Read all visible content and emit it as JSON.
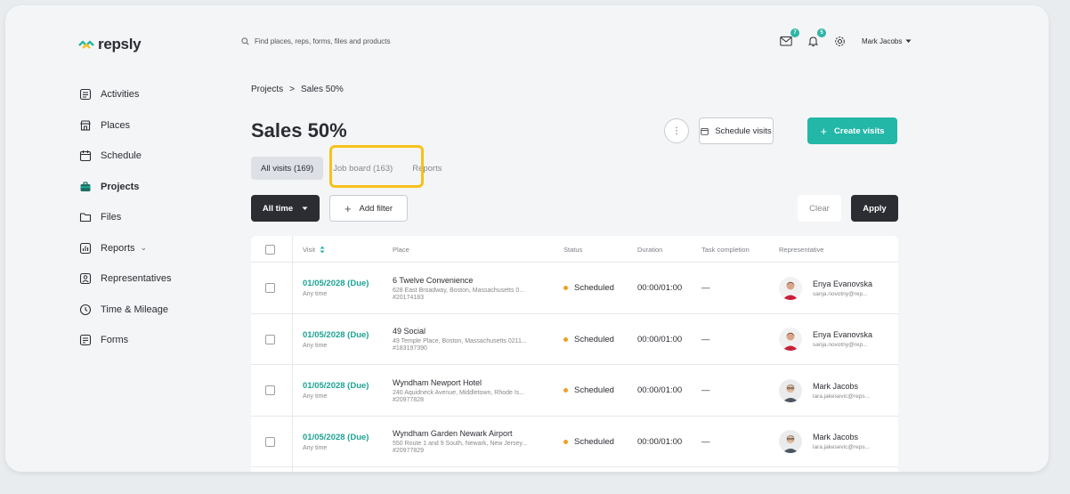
{
  "app": {
    "logo_text": "repsly",
    "brand_color": "#23b7a7",
    "highlight_color": "#f6c11a"
  },
  "topbar": {
    "search_placeholder": "Find places, reps, forms, files and products",
    "mail_badge": "7",
    "bell_badge": "5",
    "user_name": "Mark Jacobs"
  },
  "sidebar": {
    "items": [
      {
        "label": "Activities",
        "icon": "list-icon"
      },
      {
        "label": "Places",
        "icon": "store-icon"
      },
      {
        "label": "Schedule",
        "icon": "calendar-icon"
      },
      {
        "label": "Projects",
        "icon": "briefcase-icon"
      },
      {
        "label": "Files",
        "icon": "folder-icon"
      },
      {
        "label": "Reports",
        "icon": "chart-icon"
      },
      {
        "label": "Representatives",
        "icon": "person-icon"
      },
      {
        "label": "Time & Mileage",
        "icon": "clock-icon"
      },
      {
        "label": "Forms",
        "icon": "form-icon"
      }
    ]
  },
  "breadcrumb": {
    "parent": "Projects",
    "separator": ">",
    "current": "Sales 50%"
  },
  "page": {
    "title": "Sales 50%",
    "more_label": "⋮",
    "schedule_label": "Schedule visits",
    "create_label": "Create visits"
  },
  "tabs": [
    {
      "label": "All visits (169)"
    },
    {
      "label": "Job board (163)"
    },
    {
      "label": "Reports"
    }
  ],
  "filters": {
    "time_label": "All time",
    "add_filter_label": "Add filter",
    "clear_label": "Clear",
    "apply_label": "Apply"
  },
  "table": {
    "headers": {
      "visit": "Visit",
      "place": "Place",
      "status": "Status",
      "duration": "Duration",
      "task": "Task completion",
      "rep": "Representative"
    },
    "rows": [
      {
        "date": "01/05/2028 (Due)",
        "time": "Any time",
        "place": "6 Twelve Convenience",
        "address": "628 East Broadway, Boston, Massachusetts 0...",
        "place_id": "#20174183",
        "status": "Scheduled",
        "duration": "00:00/01:00",
        "task": "—",
        "rep_name": "Enya Evanovska",
        "rep_email": "sanja.novotny@rep..."
      },
      {
        "date": "01/05/2028 (Due)",
        "time": "Any time",
        "place": "49 Social",
        "address": "49 Temple Place, Boston, Massachusetts 0211...",
        "place_id": "#183197390",
        "status": "Scheduled",
        "duration": "00:00/01:00",
        "task": "—",
        "rep_name": "Enya Evanovska",
        "rep_email": "sanja.novotny@rep..."
      },
      {
        "date": "01/05/2028 (Due)",
        "time": "Any time",
        "place": "Wyndham Newport Hotel",
        "address": "240 Aquidneck Avenue, Middletown, Rhode Is...",
        "place_id": "#20977828",
        "status": "Scheduled",
        "duration": "00:00/01:00",
        "task": "—",
        "rep_name": "Mark Jacobs",
        "rep_email": "lara.jakesevic@reps..."
      },
      {
        "date": "01/05/2028 (Due)",
        "time": "Any time",
        "place": "Wyndham Garden Newark Airport",
        "address": "550 Route 1 and 9 South, Newark, New Jersey...",
        "place_id": "#20977829",
        "status": "Scheduled",
        "duration": "00:00/01:00",
        "task": "—",
        "rep_name": "Mark Jacobs",
        "rep_email": "lara.jakesevic@reps..."
      }
    ]
  }
}
